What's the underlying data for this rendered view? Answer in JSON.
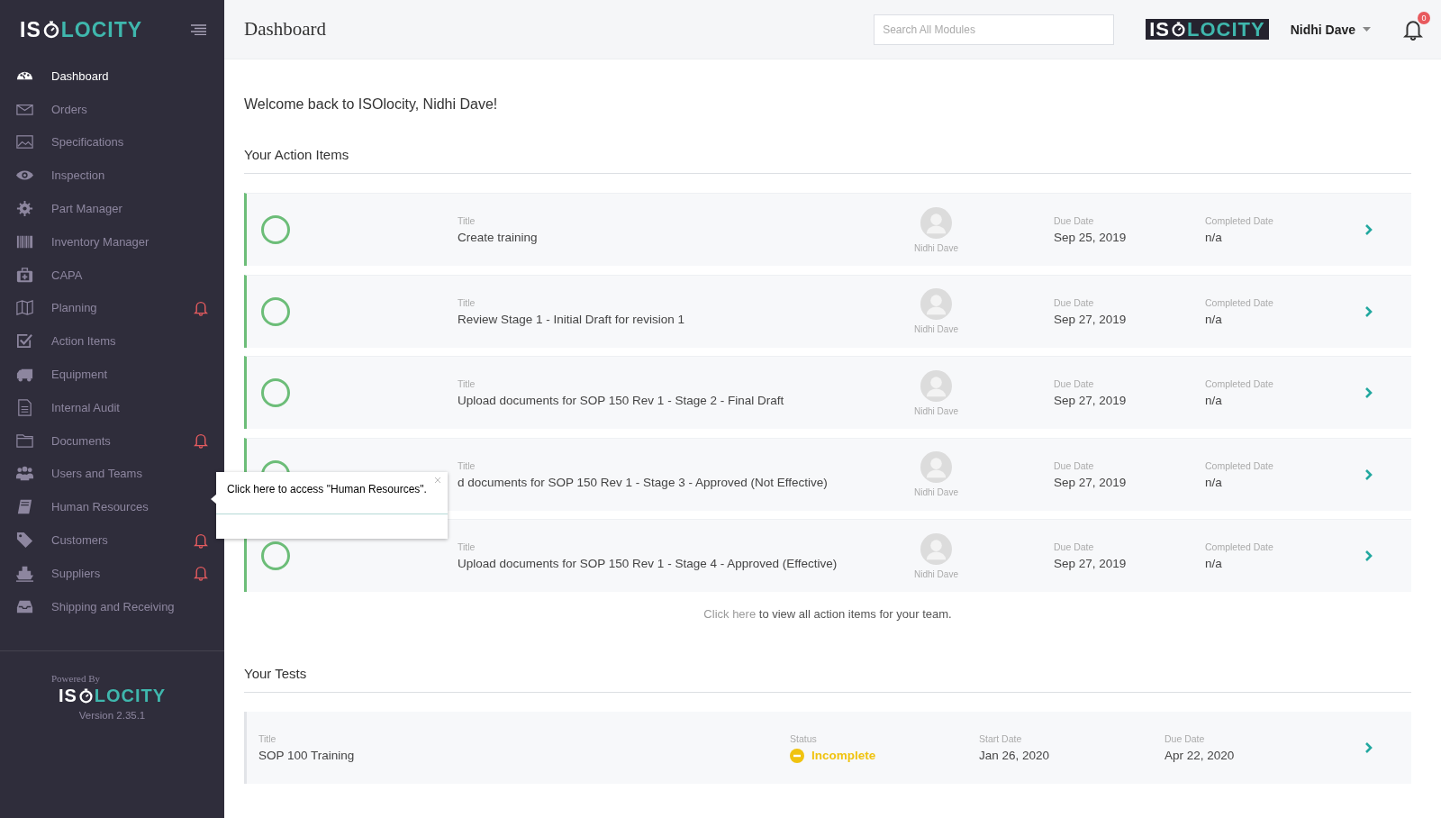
{
  "sidebar": {
    "logo": {
      "left": "IS",
      "right": "LOCITY"
    },
    "items": [
      {
        "label": "Dashboard",
        "selected": true,
        "alert": false
      },
      {
        "label": "Orders",
        "selected": false,
        "alert": false
      },
      {
        "label": "Specifications",
        "selected": false,
        "alert": false
      },
      {
        "label": "Inspection",
        "selected": false,
        "alert": false
      },
      {
        "label": "Part Manager",
        "selected": false,
        "alert": false
      },
      {
        "label": "Inventory Manager",
        "selected": false,
        "alert": false
      },
      {
        "label": "CAPA",
        "selected": false,
        "alert": false
      },
      {
        "label": "Planning",
        "selected": false,
        "alert": true
      },
      {
        "label": "Action Items",
        "selected": false,
        "alert": false
      },
      {
        "label": "Equipment",
        "selected": false,
        "alert": false
      },
      {
        "label": "Internal Audit",
        "selected": false,
        "alert": false
      },
      {
        "label": "Documents",
        "selected": false,
        "alert": true
      },
      {
        "label": "Users and Teams",
        "selected": false,
        "alert": false
      },
      {
        "label": "Human Resources",
        "selected": false,
        "alert": false
      },
      {
        "label": "Customers",
        "selected": false,
        "alert": true
      },
      {
        "label": "Suppliers",
        "selected": false,
        "alert": true
      },
      {
        "label": "Shipping and Receiving",
        "selected": false,
        "alert": false
      }
    ],
    "footer": {
      "powered_by": "Powered By",
      "logo": {
        "left": "IS",
        "right": "LOCITY"
      },
      "version": "Version 2.35.1"
    }
  },
  "header": {
    "title": "Dashboard",
    "search": {
      "placeholder": "Search All Modules"
    },
    "logo": {
      "left": "IS",
      "right": "LOCITY"
    },
    "user": "Nidhi Dave",
    "notification_count": "0"
  },
  "tooltip": {
    "text": "Click here to access \"Human Resources\"."
  },
  "welcome": "Welcome back to ISOlocity, Nidhi Dave!",
  "action_items": {
    "heading": "Your Action Items",
    "items": [
      {
        "title_label": "Title",
        "title": "Create training",
        "assignee": "Nidhi Dave",
        "due_label": "Due Date",
        "due": "Sep 25, 2019",
        "completed_label": "Completed Date",
        "completed": "n/a"
      },
      {
        "title_label": "Title",
        "title": "Review Stage 1 - Initial Draft for revision 1",
        "assignee": "Nidhi Dave",
        "due_label": "Due Date",
        "due": "Sep 27, 2019",
        "completed_label": "Completed Date",
        "completed": "n/a"
      },
      {
        "title_label": "Title",
        "title": "Upload documents for SOP 150 Rev 1 - Stage 2 - Final Draft",
        "assignee": "Nidhi Dave",
        "due_label": "Due Date",
        "due": "Sep 27, 2019",
        "completed_label": "Completed Date",
        "completed": "n/a"
      },
      {
        "title_label": "Title",
        "title": "d documents for SOP 150 Rev 1 - Stage 3 - Approved (Not Effective)",
        "assignee": "Nidhi Dave",
        "due_label": "Due Date",
        "due": "Sep 27, 2019",
        "completed_label": "Completed Date",
        "completed": "n/a"
      },
      {
        "title_label": "Title",
        "title": "Upload documents for SOP 150 Rev 1 - Stage 4 - Approved (Effective)",
        "assignee": "Nidhi Dave",
        "due_label": "Due Date",
        "due": "Sep 27, 2019",
        "completed_label": "Completed Date",
        "completed": "n/a"
      }
    ],
    "footer": {
      "link": "Click here",
      "text": "to view all action items for your team."
    }
  },
  "tests": {
    "heading": "Your Tests",
    "items": [
      {
        "title_label": "Title",
        "title": "SOP 100 Training",
        "status_label": "Status",
        "status": "Incomplete",
        "start_label": "Start Date",
        "start": "Jan 26, 2020",
        "due_label": "Due Date",
        "due": "Apr 22, 2020"
      }
    ]
  }
}
